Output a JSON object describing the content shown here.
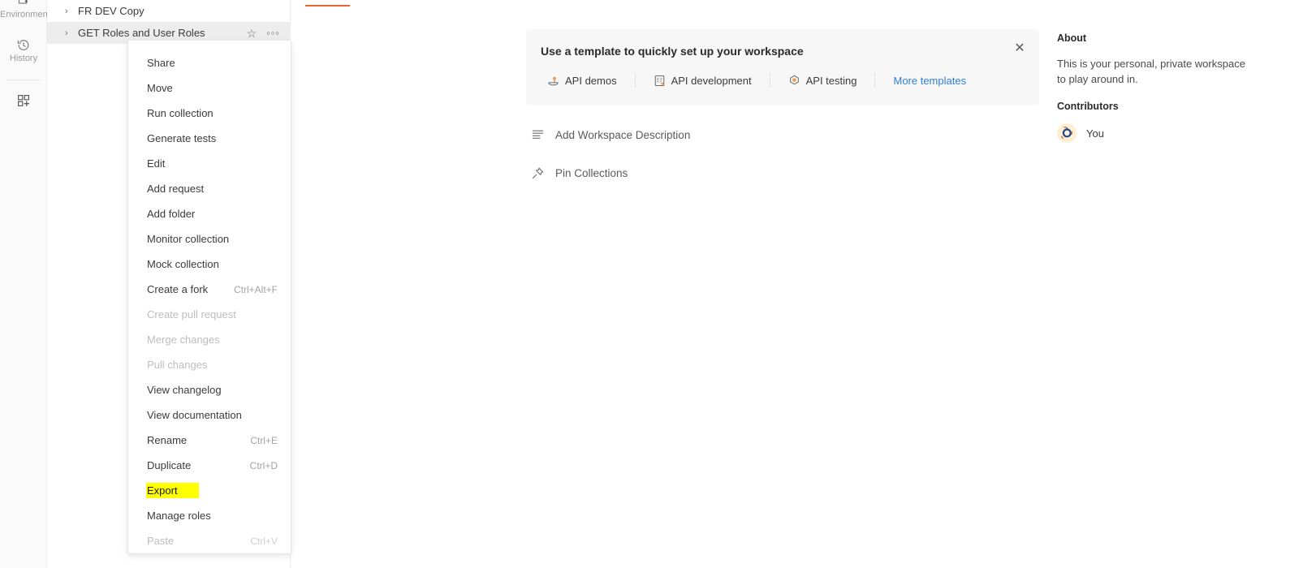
{
  "rail": {
    "items": [
      {
        "label": "Environments",
        "icon": "environments-icon"
      },
      {
        "label": "History",
        "icon": "history-icon"
      },
      {
        "label": "",
        "icon": "new-workspace-icon"
      }
    ]
  },
  "sidebar": {
    "collections": [
      {
        "name": "FR DEV Copy",
        "selected": false,
        "chevron": "›"
      },
      {
        "name": "GET Roles and User Roles",
        "selected": true,
        "chevron": "›"
      }
    ],
    "star_glyph": "☆",
    "more_glyph": "◦◦◦"
  },
  "context_menu": {
    "items": [
      {
        "label": "Share",
        "shortcut": "",
        "disabled": false,
        "highlighted": false
      },
      {
        "label": "Move",
        "shortcut": "",
        "disabled": false,
        "highlighted": false
      },
      {
        "label": "Run collection",
        "shortcut": "",
        "disabled": false,
        "highlighted": false
      },
      {
        "label": "Generate tests",
        "shortcut": "",
        "disabled": false,
        "highlighted": false
      },
      {
        "label": "Edit",
        "shortcut": "",
        "disabled": false,
        "highlighted": false
      },
      {
        "label": "Add request",
        "shortcut": "",
        "disabled": false,
        "highlighted": false
      },
      {
        "label": "Add folder",
        "shortcut": "",
        "disabled": false,
        "highlighted": false
      },
      {
        "label": "Monitor collection",
        "shortcut": "",
        "disabled": false,
        "highlighted": false
      },
      {
        "label": "Mock collection",
        "shortcut": "",
        "disabled": false,
        "highlighted": false
      },
      {
        "label": "Create a fork",
        "shortcut": "Ctrl+Alt+F",
        "disabled": false,
        "highlighted": false
      },
      {
        "label": "Create pull request",
        "shortcut": "",
        "disabled": true,
        "highlighted": false
      },
      {
        "label": "Merge changes",
        "shortcut": "",
        "disabled": true,
        "highlighted": false
      },
      {
        "label": "Pull changes",
        "shortcut": "",
        "disabled": true,
        "highlighted": false
      },
      {
        "label": "View changelog",
        "shortcut": "",
        "disabled": false,
        "highlighted": false
      },
      {
        "label": "View documentation",
        "shortcut": "",
        "disabled": false,
        "highlighted": false
      },
      {
        "label": "Rename",
        "shortcut": "Ctrl+E",
        "disabled": false,
        "highlighted": false
      },
      {
        "label": "Duplicate",
        "shortcut": "Ctrl+D",
        "disabled": false,
        "highlighted": false
      },
      {
        "label": "Export",
        "shortcut": "",
        "disabled": false,
        "highlighted": true
      },
      {
        "label": "Manage roles",
        "shortcut": "",
        "disabled": false,
        "highlighted": false
      },
      {
        "label": "Paste",
        "shortcut": "Ctrl+V",
        "disabled": true,
        "highlighted": false
      }
    ],
    "highlight_color": "#ffff00"
  },
  "main": {
    "tab_indicator_color": "#eb6234",
    "template_banner": {
      "title": "Use a template to quickly set up your workspace",
      "close_glyph": "✕",
      "chips": [
        {
          "label": "API demos",
          "icon": "api-demos-icon"
        },
        {
          "label": "API development",
          "icon": "api-development-icon"
        },
        {
          "label": "API testing",
          "icon": "api-testing-icon"
        }
      ],
      "more_link": "More templates",
      "link_color": "#2f7fd8"
    },
    "actions": [
      {
        "label": "Add Workspace Description",
        "icon": "description-icon"
      },
      {
        "label": "Pin Collections",
        "icon": "pin-icon"
      }
    ]
  },
  "about": {
    "heading": "About",
    "description": "This is your personal, private workspace to play around in.",
    "contributors_heading": "Contributors",
    "contributors": [
      {
        "name": "You",
        "avatar": "postman-avatar"
      }
    ]
  }
}
